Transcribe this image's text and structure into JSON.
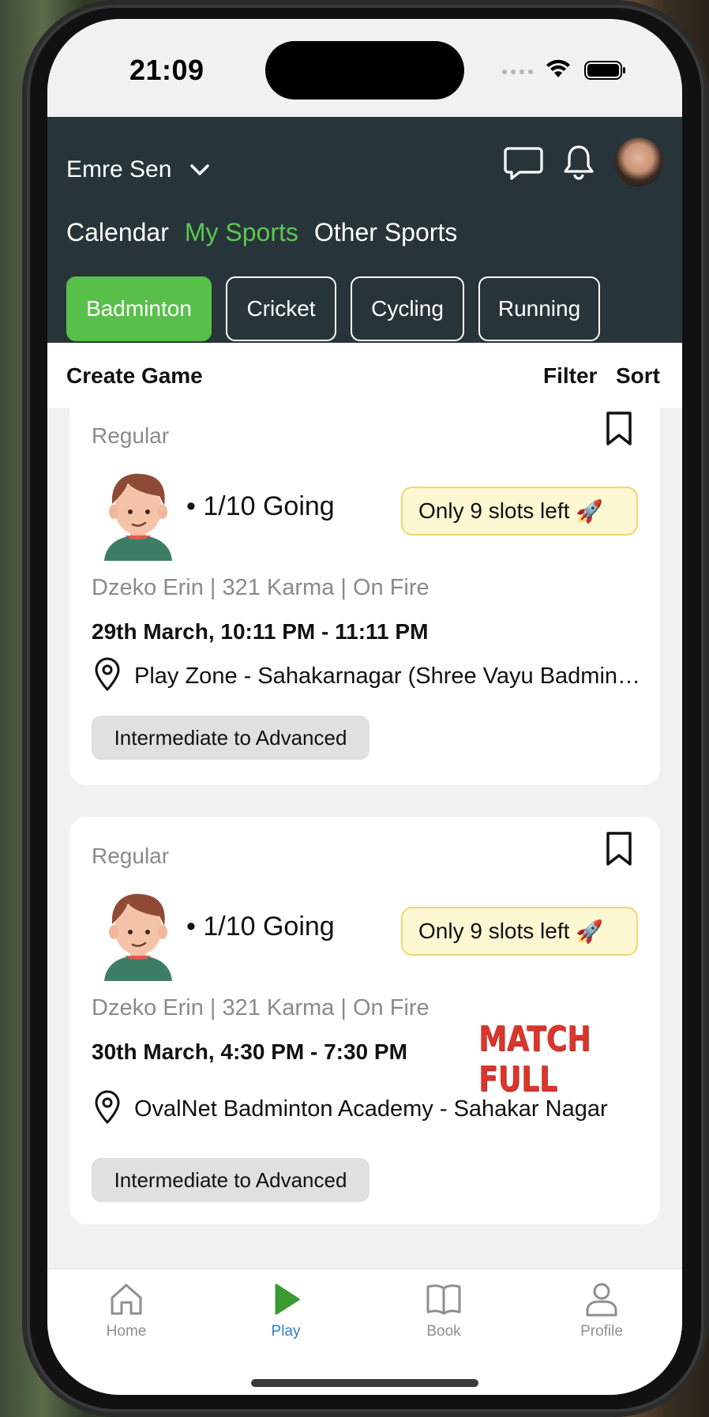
{
  "status_bar": {
    "time": "21:09"
  },
  "header": {
    "user_name": "Emre Sen",
    "tabs": [
      {
        "label": "Calendar",
        "active": false
      },
      {
        "label": "My Sports",
        "active": true
      },
      {
        "label": "Other Sports",
        "active": false
      }
    ],
    "sports": [
      {
        "label": "Badminton",
        "active": true
      },
      {
        "label": "Cricket",
        "active": false
      },
      {
        "label": "Cycling",
        "active": false
      },
      {
        "label": "Running",
        "active": false
      }
    ]
  },
  "action_bar": {
    "create_game": "Create Game",
    "filter": "Filter",
    "sort": "Sort"
  },
  "games": [
    {
      "type": "Regular",
      "going": "• 1/10 Going",
      "slots": "Only 9 slots left",
      "slots_emoji": "🚀",
      "host": "Dzeko Erin | 321 Karma | On Fire",
      "datetime": "29th March, 10:11 PM - 11:11 PM",
      "venue": "Play Zone - Sahakarnagar (Shree Vayu Badminton Court)",
      "level": "Intermediate to Advanced",
      "stamp": ""
    },
    {
      "type": "Regular",
      "going": "• 1/10 Going",
      "slots": "Only 9 slots left",
      "slots_emoji": "🚀",
      "host": "Dzeko Erin | 321 Karma | On Fire",
      "datetime": "30th March, 4:30 PM - 7:30 PM",
      "venue": "OvalNet Badminton Academy - Sahakar Nagar",
      "level": "Intermediate to Advanced",
      "stamp": "MATCH FULL"
    }
  ],
  "bottom_nav": [
    {
      "label": "Home",
      "icon": "home-icon",
      "active": false
    },
    {
      "label": "Play",
      "icon": "play-icon",
      "active": true
    },
    {
      "label": "Book",
      "icon": "book-icon",
      "active": false
    },
    {
      "label": "Profile",
      "icon": "profile-icon",
      "active": false
    }
  ],
  "colors": {
    "header_bg": "#27353a",
    "accent_green": "#58c04a",
    "active_tab": "#5cc94e",
    "nav_active": "#2f7fd6",
    "stamp_red": "#d9362d"
  }
}
